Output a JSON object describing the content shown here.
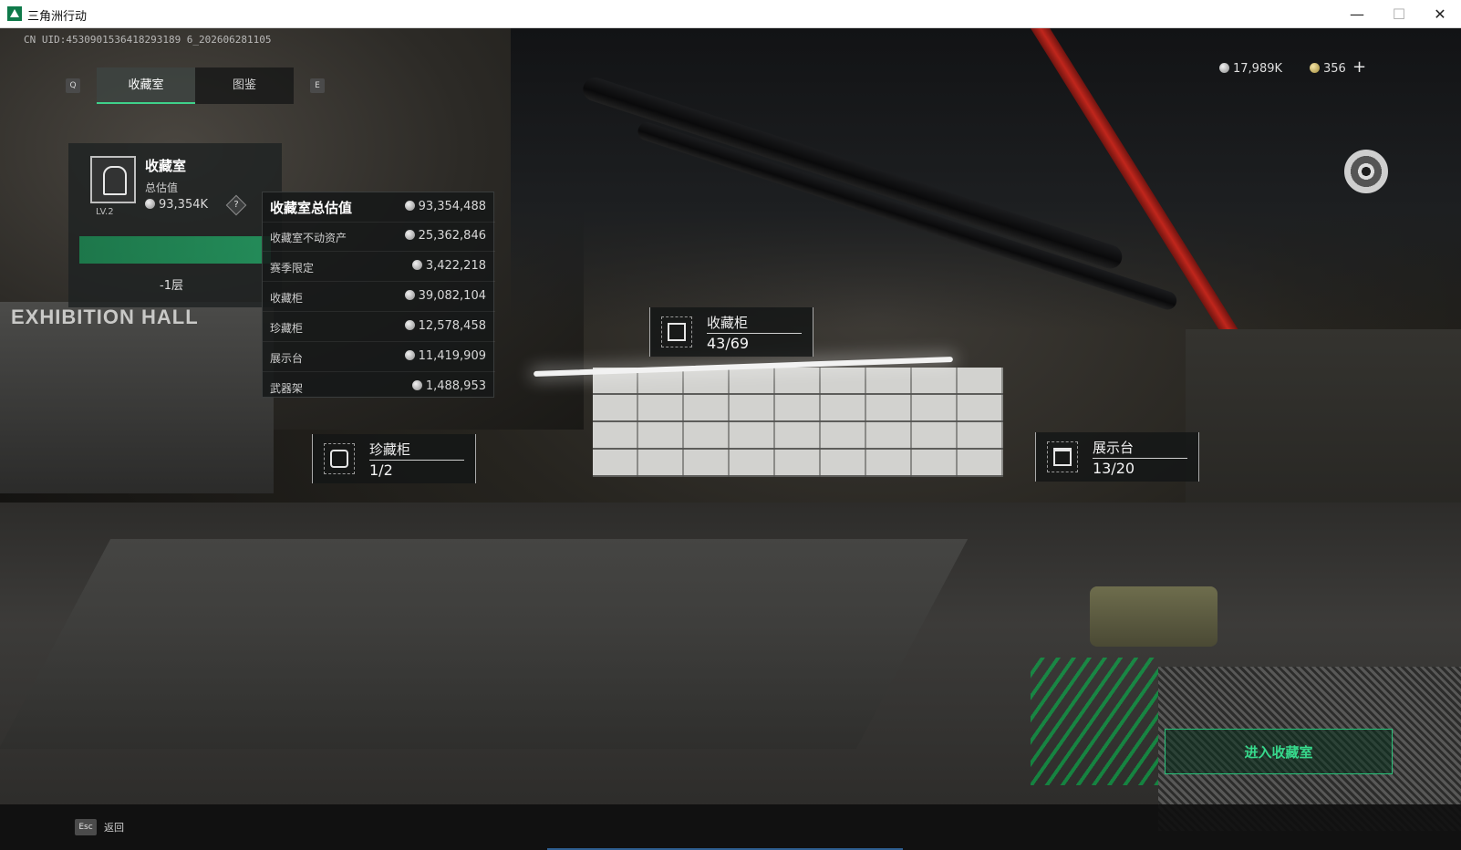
{
  "window": {
    "title": "三角洲行动",
    "minimize": "—",
    "maximize": "☐",
    "close": "✕"
  },
  "uid": "CN UID:4530901536418293189 6_202606281105",
  "tabs": {
    "q_key": "Q",
    "e_key": "E",
    "items": [
      {
        "label": "收藏室",
        "active": true
      },
      {
        "label": "图鉴",
        "active": false
      }
    ]
  },
  "currency": {
    "silver": "17,989K",
    "gold": "356",
    "plus": "+"
  },
  "room": {
    "title": "收藏室",
    "level": "LV.2",
    "subtitle": "总估值",
    "value": "93,354K",
    "help": "?",
    "floor": "-1层"
  },
  "breakdown": {
    "title": "收藏室总估值",
    "total": "93,354,488",
    "rows": [
      {
        "label": "收藏室不动资产",
        "value": "25,362,846"
      },
      {
        "label": "赛季限定",
        "value": "3,422,218"
      },
      {
        "label": "收藏柜",
        "value": "39,082,104"
      },
      {
        "label": "珍藏柜",
        "value": "12,578,458"
      },
      {
        "label": "展示台",
        "value": "11,419,909"
      },
      {
        "label": "武器架",
        "value": "1,488,953"
      }
    ]
  },
  "markers": {
    "cabinet": {
      "name": "收藏柜",
      "count": "43/69"
    },
    "rare": {
      "name": "珍藏柜",
      "count": "1/2"
    },
    "stand": {
      "name": "展示台",
      "count": "13/20"
    }
  },
  "scene": {
    "hall_sign": "EXHIBITION HALL"
  },
  "enter_button": "进入收藏室",
  "footer": {
    "esc_key": "Esc",
    "back_label": "返回"
  }
}
